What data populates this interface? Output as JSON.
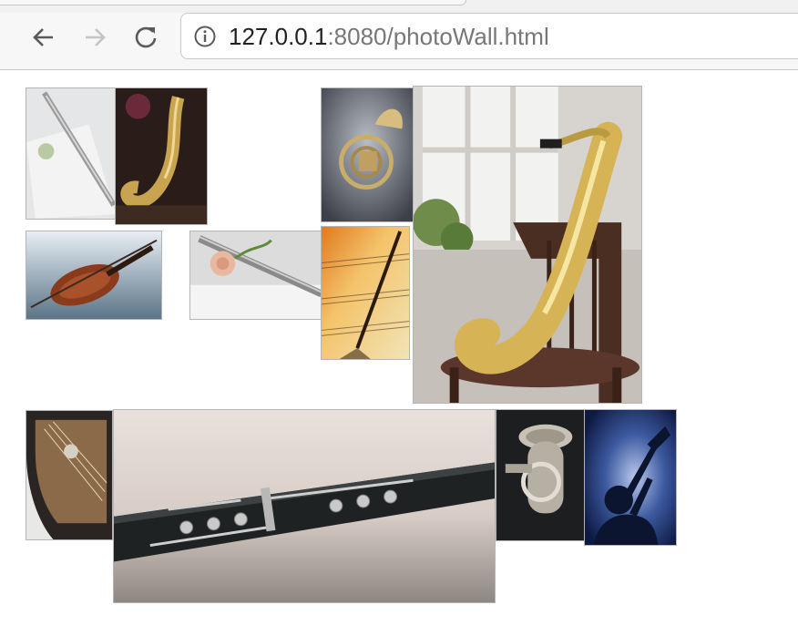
{
  "browser": {
    "back_icon": "arrow-left-icon",
    "forward_icon": "arrow-right-icon",
    "reload_icon": "reload-icon",
    "info_icon": "info-circle-icon",
    "url_host": "127.0.0.1",
    "url_rest": ":8080/photoWall.html"
  },
  "photos": [
    "flute",
    "saxophone",
    "french-horn",
    "saxophone-on-chair",
    "violin",
    "flute-with-rose",
    "sheet-music",
    "piano",
    "clarinet",
    "tuba",
    "trumpet-player"
  ]
}
